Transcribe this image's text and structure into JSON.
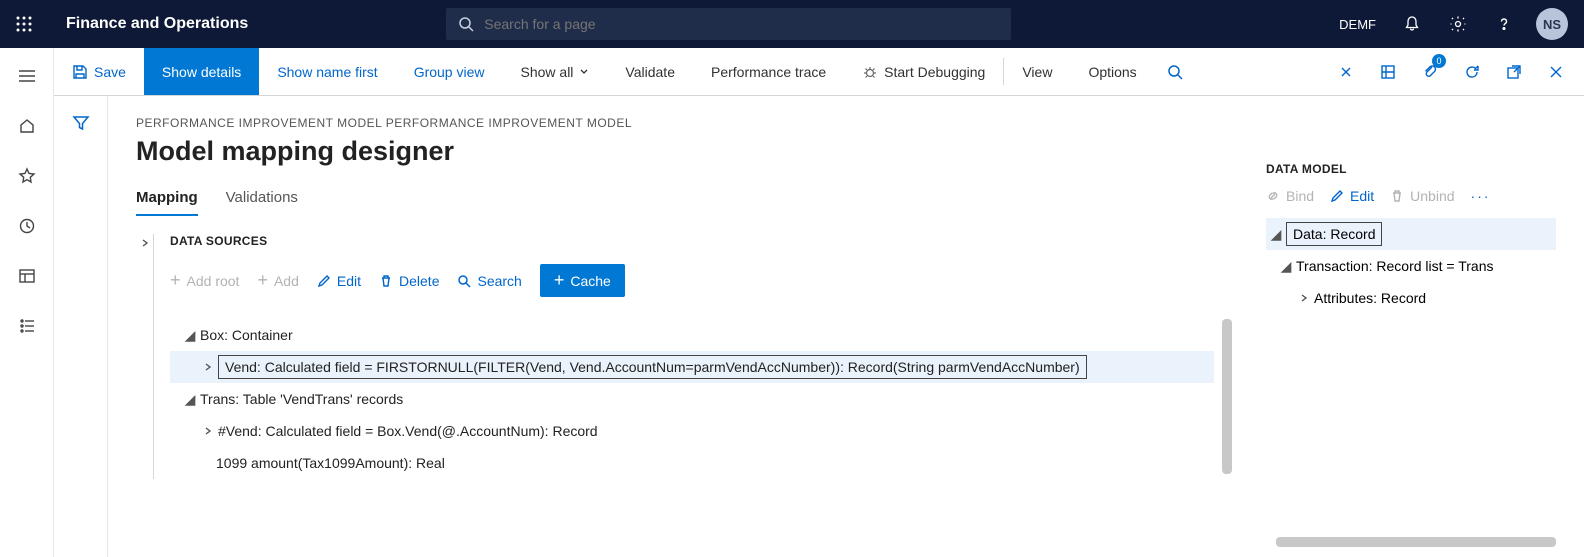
{
  "topbar": {
    "app_title": "Finance and Operations",
    "search_placeholder": "Search for a page",
    "environment": "DEMF",
    "avatar_initials": "NS"
  },
  "cmdbar": {
    "save": "Save",
    "show_details": "Show details",
    "show_name_first": "Show name first",
    "group_view": "Group view",
    "show_all": "Show all",
    "validate": "Validate",
    "perf_trace": "Performance trace",
    "start_debugging": "Start Debugging",
    "view": "View",
    "options": "Options",
    "attach_badge": "0"
  },
  "page": {
    "breadcrumb": "PERFORMANCE IMPROVEMENT MODEL PERFORMANCE IMPROVEMENT MODEL",
    "title": "Model mapping designer",
    "tab_mapping": "Mapping",
    "tab_validations": "Validations"
  },
  "datasources": {
    "title": "DATA SOURCES",
    "add_root": "Add root",
    "add": "Add",
    "edit": "Edit",
    "delete": "Delete",
    "search": "Search",
    "cache": "Cache",
    "tree": {
      "box": "Box: Container",
      "vend": "Vend: Calculated field = FIRSTORNULL(FILTER(Vend, Vend.AccountNum=parmVendAccNumber)): Record(String parmVendAccNumber)",
      "trans": "Trans: Table 'VendTrans' records",
      "hash_vend": "#Vend: Calculated field = Box.Vend(@.AccountNum): Record",
      "tax": "1099 amount(Tax1099Amount): Real"
    }
  },
  "datamodel": {
    "title": "DATA MODEL",
    "bind": "Bind",
    "edit": "Edit",
    "unbind": "Unbind",
    "tree": {
      "data": "Data: Record",
      "transaction": "Transaction: Record list = Trans",
      "attributes": "Attributes: Record"
    }
  }
}
